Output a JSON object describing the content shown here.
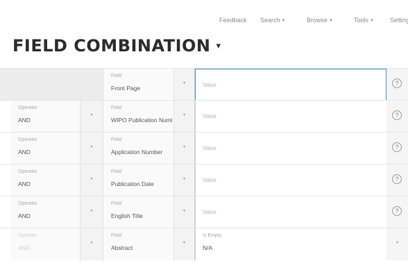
{
  "topnav": {
    "items": [
      {
        "label": "Feedback",
        "has_menu": false
      },
      {
        "label": "Search",
        "has_menu": true
      },
      {
        "label": "Browse",
        "has_menu": true
      },
      {
        "label": "Tools",
        "has_menu": true
      },
      {
        "label": "Settings",
        "has_menu": false
      }
    ]
  },
  "page": {
    "title": "FIELD COMBINATION",
    "title_caret": "▾"
  },
  "rows": [
    {
      "operator_label": "",
      "operator_value": "",
      "field_label": "Field",
      "field_value": "Front Page",
      "value_label": "",
      "value_placeholder": "Value",
      "value_value": "",
      "active": true
    },
    {
      "operator_label": "Operator",
      "operator_value": "AND",
      "field_label": "Field",
      "field_value": "WIPO Publication Number",
      "value_label": "",
      "value_placeholder": "Value",
      "value_value": ""
    },
    {
      "operator_label": "Operator",
      "operator_value": "AND",
      "field_label": "Field",
      "field_value": "Application Number",
      "value_label": "",
      "value_placeholder": "Value",
      "value_value": ""
    },
    {
      "operator_label": "Operator",
      "operator_value": "AND",
      "field_label": "Field",
      "field_value": "Publication Date",
      "value_label": "",
      "value_placeholder": "Value",
      "value_value": ""
    },
    {
      "operator_label": "Operator",
      "operator_value": "AND",
      "field_label": "Field",
      "field_value": "English Title",
      "value_label": "",
      "value_placeholder": "Value",
      "value_value": ""
    },
    {
      "operator_label": "Operator",
      "operator_value": "AND",
      "field_label": "Field",
      "field_value": "Abstract",
      "value_label": "Is Empty",
      "value_placeholder": "",
      "value_value": "N/A",
      "faded": true
    }
  ],
  "icons": {
    "dropdown": "chevron-down-icon",
    "help": "question-circle-icon",
    "help_glyph": "?",
    "arrow_glyph": "▾"
  },
  "colors": {
    "active_border": "#3d8fd1",
    "row_background": "#fafafa"
  }
}
